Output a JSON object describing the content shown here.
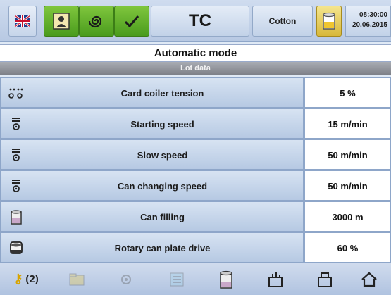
{
  "header": {
    "machine": "TC",
    "material": "Cotton",
    "time": "08:30:00",
    "date": "20.06.2015"
  },
  "mode_title": "Automatic mode",
  "section_title": "Lot data",
  "rows": [
    {
      "label": "Card coiler tension",
      "value": "5 %"
    },
    {
      "label": "Starting speed",
      "value": "15 m/min"
    },
    {
      "label": "Slow speed",
      "value": "50 m/min"
    },
    {
      "label": "Can changing speed",
      "value": "50 m/min"
    },
    {
      "label": "Can filling",
      "value": "3000 m"
    },
    {
      "label": "Rotary can plate drive",
      "value": "60 %"
    }
  ],
  "footer": {
    "keys_count": "(2)"
  },
  "colors": {
    "active_green": "#5aac27",
    "panel_blue": "#c6d5ea",
    "header_gray": "#8e9199"
  }
}
